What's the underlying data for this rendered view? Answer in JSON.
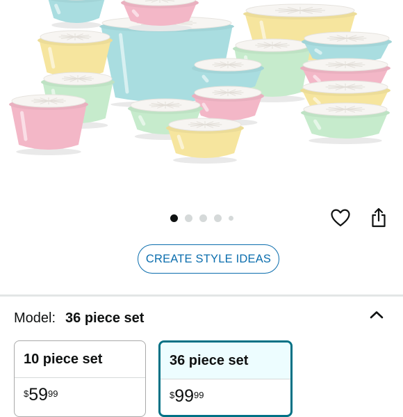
{
  "product_image": {
    "description": "Pastel bowls with white lids",
    "colors": {
      "pink": "#f3b7c7",
      "yellow": "#f6e59e",
      "blue": "#a9dde0",
      "mint": "#c6ebcc",
      "lid": "#f7f5f2"
    }
  },
  "carousel": {
    "count": 5,
    "active_index": 0
  },
  "actions": {
    "wishlist_icon": "heart-icon",
    "share_icon": "share-icon"
  },
  "style_ideas": {
    "label": "CREATE STYLE IDEAS"
  },
  "variation": {
    "label": "Model:",
    "selected": "36 piece set",
    "collapse_icon": "chevron-up-icon",
    "options": [
      {
        "name": "10 piece set",
        "currency": "$",
        "whole": "59",
        "fraction": "99",
        "selected": false
      },
      {
        "name": "36 piece set",
        "currency": "$",
        "whole": "99",
        "fraction": "99",
        "selected": true
      }
    ]
  },
  "theme": {
    "link_blue": "#0a6dad",
    "selected_border": "#007185",
    "selected_bg": "#edfdff"
  }
}
